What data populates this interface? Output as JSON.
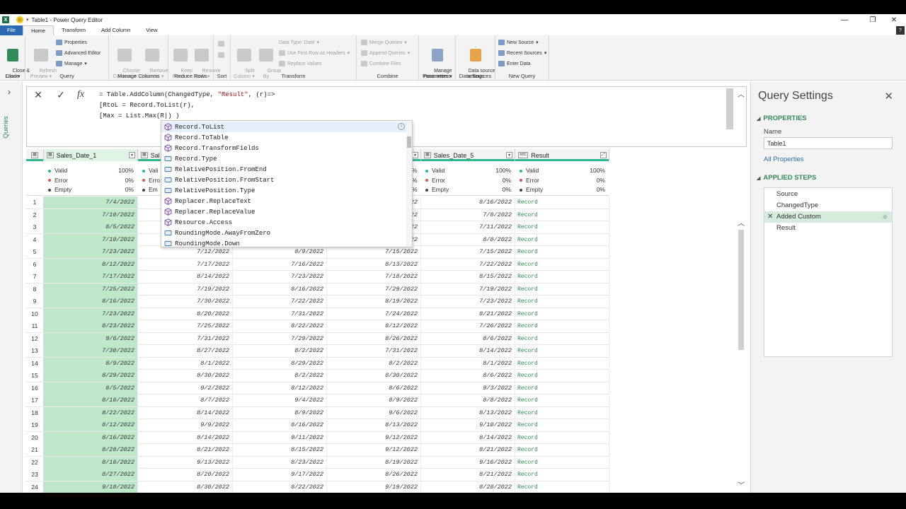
{
  "window": {
    "title": "Table1 - Power Query Editor",
    "smiley": "☺"
  },
  "tabs": [
    "File",
    "Home",
    "Transform",
    "Add Column",
    "View"
  ],
  "ribbon": {
    "close_load": "Close &\nLoad",
    "close_label": "Close",
    "refresh_preview": "Refresh\nPreview",
    "properties": "Properties",
    "advanced_editor": "Advanced Editor",
    "manage": "Manage",
    "query_label": "Query",
    "choose_columns": "Choose\nColumns",
    "remove_columns": "Remove\nColumns",
    "manage_columns_label": "Manage Columns",
    "keep_rows": "Keep\nRows",
    "remove_rows": "Remove\nRows",
    "reduce_rows_label": "Reduce Rows",
    "sort_label": "Sort",
    "split_column": "Split\nColumn",
    "group_by": "Group\nBy",
    "data_type": "Data Type: Date",
    "use_first_row": "Use First Row as Headers",
    "replace_values": "Replace Values",
    "transform_label": "Transform",
    "merge_queries": "Merge Queries",
    "append_queries": "Append Queries",
    "combine_files": "Combine Files",
    "combine_label": "Combine",
    "manage_parameters": "Manage\nParameters",
    "parameters_label": "Parameters",
    "data_source_settings": "Data source\nsettings",
    "data_sources_label": "Data Sources",
    "new_source": "New Source",
    "recent_sources": "Recent Sources",
    "enter_data": "Enter Data",
    "new_query_label": "New Query"
  },
  "queries_pane": {
    "label": "Queries"
  },
  "formula": {
    "line1a": "= Table.AddColumn(ChangedType, ",
    "line1str": "\"Result\"",
    "line1b": ", (r)=>",
    "line2": "[RtoL = Record.ToList(r),",
    "line3": "[Max = List.Max(R|) )"
  },
  "autocomplete": [
    {
      "text": "Record.ToList",
      "kind": "function"
    },
    {
      "text": "Record.ToTable",
      "kind": "function"
    },
    {
      "text": "Record.TransformFields",
      "kind": "function"
    },
    {
      "text": "Record.Type",
      "kind": "constant"
    },
    {
      "text": "RelativePosition.FromEnd",
      "kind": "constant"
    },
    {
      "text": "RelativePosition.FromStart",
      "kind": "constant"
    },
    {
      "text": "RelativePosition.Type",
      "kind": "constant"
    },
    {
      "text": "Replacer.ReplaceText",
      "kind": "function"
    },
    {
      "text": "Replacer.ReplaceValue",
      "kind": "function"
    },
    {
      "text": "Resource.Access",
      "kind": "function"
    },
    {
      "text": "RoundingMode.AwayFromZero",
      "kind": "constant"
    },
    {
      "text": "RoundingMode.Down",
      "kind": "constant"
    }
  ],
  "columns": [
    {
      "name": "Sales_Date_1",
      "type": "date"
    },
    {
      "name": "Sal",
      "type": "date"
    },
    {
      "name": "",
      "type": "date"
    },
    {
      "name": "",
      "type": "date"
    },
    {
      "name": "Sales_Date_5",
      "type": "date"
    },
    {
      "name": "Result",
      "type": "any"
    }
  ],
  "quality": {
    "valid_label": "Valid",
    "error_label": "Error",
    "empty_label": "Empty",
    "valid_pct": "100%",
    "error_pct": "0%",
    "empty_pct": "0%",
    "partial_valid": "Vali",
    "partial_error": "Erro",
    "partial_empty": "Em",
    "pct_cut": "%"
  },
  "rows": [
    [
      "7/4/2022",
      "",
      "",
      "22",
      "8/16/2022",
      "Record"
    ],
    [
      "7/10/2022",
      "",
      "",
      "22",
      "7/8/2022",
      "Record"
    ],
    [
      "8/5/2022",
      "",
      "",
      "22",
      "7/11/2022",
      "Record"
    ],
    [
      "7/10/2022",
      "",
      "",
      "22",
      "8/8/2022",
      "Record"
    ],
    [
      "7/23/2022",
      "7/12/2022",
      "8/9/2022",
      "7/15/2022",
      "7/15/2022",
      "Record"
    ],
    [
      "8/12/2022",
      "7/17/2022",
      "7/16/2022",
      "8/13/2022",
      "7/22/2022",
      "Record"
    ],
    [
      "7/17/2022",
      "8/14/2022",
      "7/23/2022",
      "7/18/2022",
      "8/15/2022",
      "Record"
    ],
    [
      "7/25/2022",
      "7/19/2022",
      "8/16/2022",
      "7/29/2022",
      "7/19/2022",
      "Record"
    ],
    [
      "8/16/2022",
      "7/30/2022",
      "7/22/2022",
      "8/19/2022",
      "7/23/2022",
      "Record"
    ],
    [
      "7/23/2022",
      "8/20/2022",
      "7/31/2022",
      "7/24/2022",
      "8/21/2022",
      "Record"
    ],
    [
      "8/23/2022",
      "7/25/2022",
      "8/22/2022",
      "8/12/2022",
      "7/26/2022",
      "Record"
    ],
    [
      "9/6/2022",
      "7/31/2022",
      "7/29/2022",
      "8/26/2022",
      "8/6/2022",
      "Record"
    ],
    [
      "7/30/2022",
      "8/27/2022",
      "8/2/2022",
      "7/31/2022",
      "8/14/2022",
      "Record"
    ],
    [
      "8/9/2022",
      "8/1/2022",
      "8/29/2022",
      "8/2/2022",
      "8/1/2022",
      "Record"
    ],
    [
      "8/29/2022",
      "8/30/2022",
      "8/2/2022",
      "8/30/2022",
      "8/6/2022",
      "Record"
    ],
    [
      "8/5/2022",
      "9/2/2022",
      "8/12/2022",
      "8/6/2022",
      "9/3/2022",
      "Record"
    ],
    [
      "8/16/2022",
      "8/7/2022",
      "9/4/2022",
      "8/9/2022",
      "8/8/2022",
      "Record"
    ],
    [
      "8/22/2022",
      "8/14/2022",
      "8/9/2022",
      "9/6/2022",
      "8/13/2022",
      "Record"
    ],
    [
      "8/12/2022",
      "9/9/2022",
      "8/16/2022",
      "8/13/2022",
      "9/10/2022",
      "Record"
    ],
    [
      "8/16/2022",
      "8/14/2022",
      "9/11/2022",
      "9/12/2022",
      "8/14/2022",
      "Record"
    ],
    [
      "8/28/2022",
      "8/21/2022",
      "8/15/2022",
      "9/12/2022",
      "8/21/2022",
      "Record"
    ],
    [
      "8/16/2022",
      "9/13/2022",
      "8/23/2022",
      "8/19/2022",
      "9/16/2022",
      "Record"
    ],
    [
      "8/27/2022",
      "8/20/2022",
      "9/17/2022",
      "8/26/2022",
      "8/21/2022",
      "Record"
    ],
    [
      "9/18/2022",
      "8/30/2022",
      "8/22/2022",
      "9/19/2022",
      "8/28/2022",
      "Record"
    ]
  ],
  "query_settings": {
    "title": "Query Settings",
    "properties_header": "PROPERTIES",
    "name_label": "Name",
    "name_value": "Table1",
    "all_properties": "All Properties",
    "applied_steps_header": "APPLIED STEPS",
    "steps": [
      "Source",
      "ChangedType",
      "Added Custom",
      "Result"
    ]
  },
  "colors": {
    "accent": "#30b58c",
    "selected_col": "#bfe8cb",
    "record": "#2c8d4e"
  }
}
